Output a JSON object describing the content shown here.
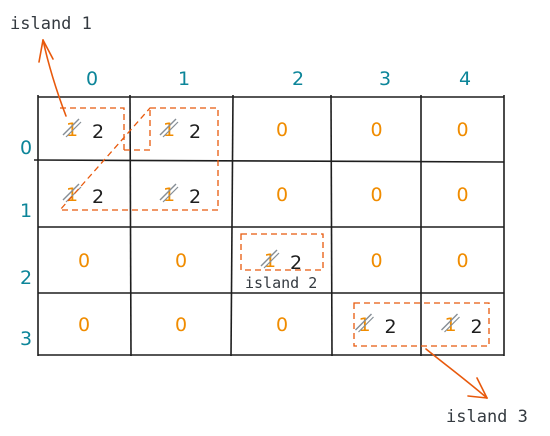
{
  "labels": {
    "island1": "island 1",
    "island2": "island 2",
    "island3": "island 3"
  },
  "col_headers": [
    "0",
    "1",
    "2",
    "3",
    "4"
  ],
  "row_headers": [
    "0",
    "1",
    "2",
    "3"
  ],
  "grid": [
    [
      {
        "orig": "1",
        "new": "2",
        "land": true
      },
      {
        "orig": "1",
        "new": "2",
        "land": true
      },
      {
        "orig": "0",
        "new": "",
        "land": false
      },
      {
        "orig": "0",
        "new": "",
        "land": false
      },
      {
        "orig": "0",
        "new": "",
        "land": false
      }
    ],
    [
      {
        "orig": "1",
        "new": "2",
        "land": true
      },
      {
        "orig": "1",
        "new": "2",
        "land": true
      },
      {
        "orig": "0",
        "new": "",
        "land": false
      },
      {
        "orig": "0",
        "new": "",
        "land": false
      },
      {
        "orig": "0",
        "new": "",
        "land": false
      }
    ],
    [
      {
        "orig": "0",
        "new": "",
        "land": false
      },
      {
        "orig": "0",
        "new": "",
        "land": false
      },
      {
        "orig": "1",
        "new": "2",
        "land": true
      },
      {
        "orig": "0",
        "new": "",
        "land": false
      },
      {
        "orig": "0",
        "new": "",
        "land": false
      }
    ],
    [
      {
        "orig": "0",
        "new": "",
        "land": false
      },
      {
        "orig": "0",
        "new": "",
        "land": false
      },
      {
        "orig": "0",
        "new": "",
        "land": false
      },
      {
        "orig": "1",
        "new": "2",
        "land": true
      },
      {
        "orig": "1",
        "new": "2",
        "land": true
      }
    ]
  ],
  "colors": {
    "grid_line": "#1e1e1e",
    "header_text": "#0c8599",
    "zero_text": "#f08c00",
    "new_text": "#1e1e1e",
    "strike": "#868e96",
    "island_box": "#e8590c",
    "arrow": "#e8590c",
    "label_text": "#343a40"
  }
}
